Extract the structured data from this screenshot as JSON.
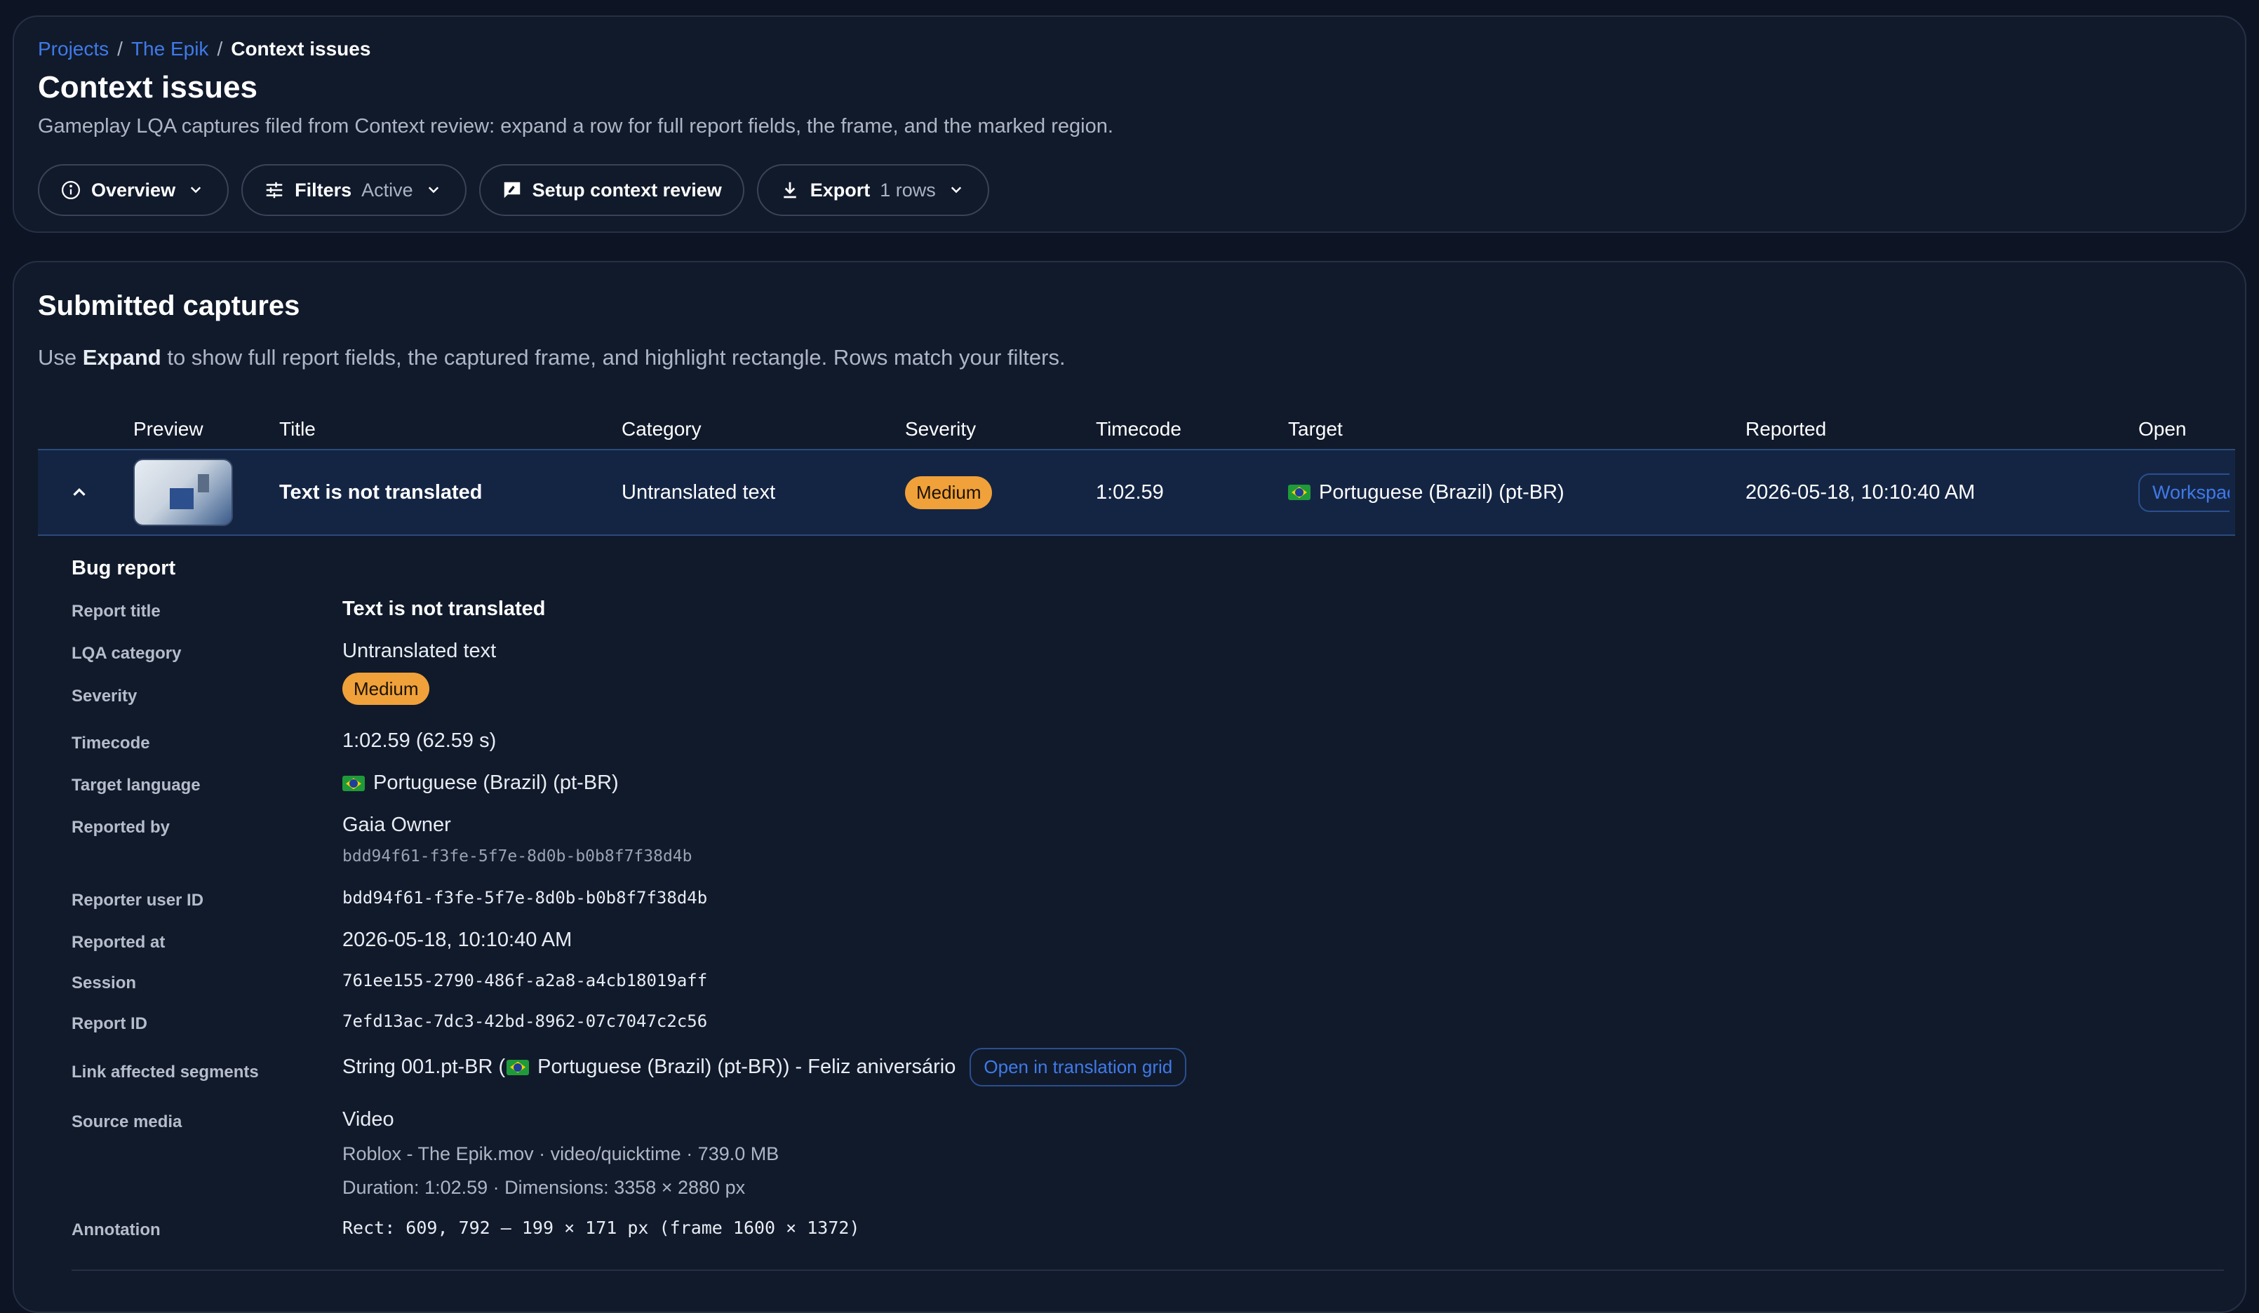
{
  "breadcrumb": {
    "projects": "Projects",
    "sep1": "/",
    "project": "The Epik",
    "sep2": "/",
    "current": "Context issues"
  },
  "page": {
    "title": "Context issues",
    "description": "Gameplay LQA captures filed from Context review: expand a row for full report fields, the frame, and the marked region."
  },
  "toolbar": {
    "overview": "Overview",
    "filters": "Filters",
    "filters_state": "Active",
    "setup": "Setup context review",
    "export": "Export",
    "export_count": "1 rows"
  },
  "section": {
    "title": "Submitted captures",
    "desc_pre": "Use ",
    "desc_bold": "Expand",
    "desc_post": " to show full report fields, the captured frame, and highlight rectangle. Rows match your filters."
  },
  "table": {
    "headers": {
      "preview": "Preview",
      "title": "Title",
      "category": "Category",
      "severity": "Severity",
      "timecode": "Timecode",
      "target": "Target",
      "reported": "Reported",
      "open": "Open"
    },
    "row": {
      "title": "Text is not translated",
      "category": "Untranslated text",
      "severity": "Medium",
      "timecode": "1:02.59",
      "target": "Portuguese (Brazil) (pt-BR)",
      "reported": "2026-05-18, 10:10:40 AM",
      "open": "Workspace"
    }
  },
  "report": {
    "heading": "Bug report",
    "labels": {
      "title": "Report title",
      "category": "LQA category",
      "severity": "Severity",
      "timecode": "Timecode",
      "target": "Target language",
      "reported_by": "Reported by",
      "reporter_id": "Reporter user ID",
      "reported_at": "Reported at",
      "session": "Session",
      "report_id": "Report ID",
      "segments": "Link affected segments",
      "source": "Source media",
      "annotation": "Annotation"
    },
    "values": {
      "title": "Text is not translated",
      "category": "Untranslated text",
      "severity": "Medium",
      "timecode": "1:02.59 (62.59 s)",
      "target": "Portuguese (Brazil) (pt-BR)",
      "reported_by": "Gaia Owner",
      "reported_by_id": "bdd94f61-f3fe-5f7e-8d0b-b0b8f7f38d4b",
      "reporter_id": "bdd94f61-f3fe-5f7e-8d0b-b0b8f7f38d4b",
      "reported_at": "2026-05-18, 10:10:40 AM",
      "session": "761ee155-2790-486f-a2a8-a4cb18019aff",
      "report_id": "7efd13ac-7dc3-42bd-8962-07c7047c2c56",
      "segment_pre": "String 001.pt-BR (",
      "segment_lang": "Portuguese (Brazil) (pt-BR)) - Feliz aniversário",
      "segment_button": "Open in translation grid",
      "source_type": "Video",
      "source_file": "Roblox - The Epik.mov · video/quicktime · 739.0 MB",
      "source_meta": "Duration: 1:02.59 · Dimensions: 3358 × 2880 px",
      "annotation": "Rect: 609, 792 — 199 × 171 px (frame 1600 × 1372)"
    }
  },
  "colors": {
    "accent": "#3f7ae8",
    "badge": "#f0a13a",
    "background": "#0d1424"
  }
}
